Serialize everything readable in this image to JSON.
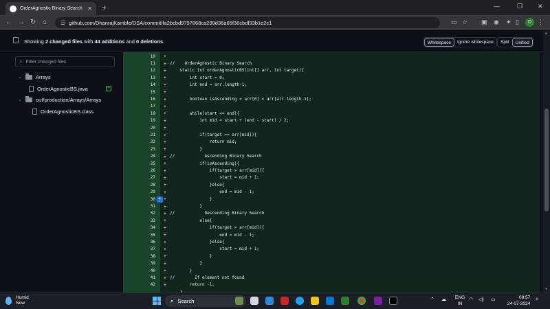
{
  "browser": {
    "tab_title": "OrderAgnostic Binary Search · D",
    "tab_close": "✕",
    "new_tab": "+",
    "url": "github.com/DhanrajKamble/DSA/commit/fa2bcbd8797868ca299d36a65f36cbdf33b1e2c1",
    "avatar_letter": "D"
  },
  "toolbar": {
    "summary_prefix": "Showing ",
    "files_changed": "2 changed files",
    "summary_mid": " with ",
    "additions": "44 additions",
    "summary_and": " and ",
    "deletions": "0 deletions",
    "summary_end": ".",
    "whitespace": "Whitespace",
    "ignore_whitespace": "Ignore whitespace",
    "split": "Split",
    "unified": "Unified"
  },
  "sidebar": {
    "filter_placeholder": "Filter changed files",
    "tree": [
      {
        "label": "Arrays",
        "kind": "folder"
      },
      {
        "label": "OrderAgnosticBS.java",
        "kind": "file",
        "status": "added"
      },
      {
        "label": "out/production/Arrays/Arrays",
        "kind": "folder"
      },
      {
        "label": "OrderAgnosticBS.class",
        "kind": "file"
      }
    ]
  },
  "diff": {
    "lines": [
      {
        "n": "10",
        "text": ""
      },
      {
        "n": "11",
        "text": "//    OrderAgnostic Binary Search"
      },
      {
        "n": "12",
        "text": "    static int orderAgnosticBS(int[] arr, int target){"
      },
      {
        "n": "13",
        "text": "        int start = 0;"
      },
      {
        "n": "14",
        "text": "        int end = arr.length-1;"
      },
      {
        "n": "15",
        "text": ""
      },
      {
        "n": "16",
        "text": "        boolean isAscending = arr[0] < arr[arr.length-1];"
      },
      {
        "n": "17",
        "text": ""
      },
      {
        "n": "18",
        "text": "        while(start <= end){"
      },
      {
        "n": "19",
        "text": "            int mid = start + (end - start) / 2;"
      },
      {
        "n": "20",
        "text": ""
      },
      {
        "n": "21",
        "text": "            if(target == arr[mid]){"
      },
      {
        "n": "22",
        "text": "                return mid;"
      },
      {
        "n": "23",
        "text": "            }"
      },
      {
        "n": "24",
        "text": "//            Ascending Binary Search"
      },
      {
        "n": "25",
        "text": "            if(isAscending){"
      },
      {
        "n": "26",
        "text": "                if(target > arr[mid]){"
      },
      {
        "n": "27",
        "text": "                    start = mid + 1;"
      },
      {
        "n": "28",
        "text": "                }else{"
      },
      {
        "n": "29",
        "text": "                    end = mid - 1;"
      },
      {
        "n": "30",
        "text": "                }"
      },
      {
        "n": "31",
        "text": "            }"
      },
      {
        "n": "32",
        "text": "//            Descending Binary Search"
      },
      {
        "n": "33",
        "text": "            else{"
      },
      {
        "n": "34",
        "text": "                if(target > arr[mid]){"
      },
      {
        "n": "35",
        "text": "                    end = mid - 1;"
      },
      {
        "n": "36",
        "text": "                }else{"
      },
      {
        "n": "37",
        "text": "                    start = mid + 1;"
      },
      {
        "n": "38",
        "text": "                }"
      },
      {
        "n": "39",
        "text": "            }"
      },
      {
        "n": "40",
        "text": "        }"
      },
      {
        "n": "41",
        "text": "//        If element not found"
      },
      {
        "n": "42",
        "text": "        return -1;"
      },
      {
        "n": "",
        "text": "    }"
      }
    ],
    "plus_sign": "+",
    "expand": "+"
  },
  "taskbar": {
    "weather_title": "Humid",
    "weather_sub": "Now",
    "search_placeholder": "Search",
    "lang_top": "ENG",
    "lang_bottom": "IN",
    "time": "08:57",
    "date": "24-07-2024"
  },
  "colors": {
    "page_bg": "#0d1117",
    "diff_added_bg": "#12261e",
    "diff_gutter_bg": "#1a4429",
    "accent_green": "#3fb950"
  }
}
